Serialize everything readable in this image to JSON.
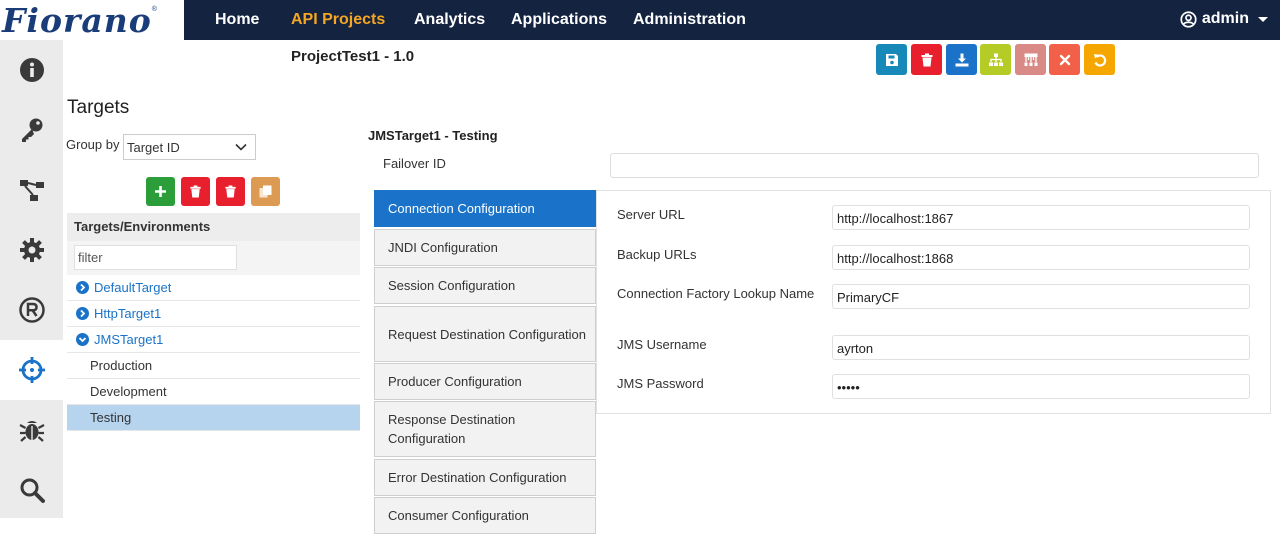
{
  "brand": {
    "logo_text": "Fiorano",
    "reg_mark": "®"
  },
  "nav": {
    "items": [
      {
        "label": "Home"
      },
      {
        "label": "API Projects",
        "active": true
      },
      {
        "label": "Analytics"
      },
      {
        "label": "Applications"
      },
      {
        "label": "Administration"
      }
    ],
    "user_label": "admin"
  },
  "sidebar": {
    "items": [
      {
        "icon": "info-icon"
      },
      {
        "icon": "key-icon"
      },
      {
        "icon": "flow-icon"
      },
      {
        "icon": "gear-icon"
      },
      {
        "icon": "registered-icon"
      },
      {
        "icon": "crosshair-icon",
        "active": true
      },
      {
        "icon": "bug-icon"
      },
      {
        "icon": "search-icon"
      }
    ]
  },
  "header": {
    "project_title": "ProjectTest1 - 1.0",
    "toolbar": [
      {
        "icon": "save-icon",
        "color": "#1789b8"
      },
      {
        "icon": "trash-icon",
        "color": "#e8202e"
      },
      {
        "icon": "download-icon",
        "color": "#1a73c8"
      },
      {
        "icon": "sitemap-icon",
        "color": "#b5cc26"
      },
      {
        "icon": "hierarchy-icon",
        "color": "#d98a86"
      },
      {
        "icon": "close-icon",
        "color": "#f26049"
      },
      {
        "icon": "undo-icon",
        "color": "#f5a700"
      }
    ]
  },
  "targets": {
    "title": "Targets",
    "group_by_label": "Group by",
    "group_by_value": "Target ID",
    "buttons": [
      {
        "icon": "plus-icon",
        "color": "#2b9e3a"
      },
      {
        "icon": "trash-icon",
        "color": "#e8202e"
      },
      {
        "icon": "trash-icon",
        "color": "#e8202e"
      },
      {
        "icon": "copy-icon",
        "color": "#dd9a52"
      }
    ],
    "tree_header": "Targets/Environments",
    "filter_placeholder": "filter",
    "tree": [
      {
        "label": "DefaultTarget",
        "expanded": false
      },
      {
        "label": "HttpTarget1",
        "expanded": false
      },
      {
        "label": "JMSTarget1",
        "expanded": true
      },
      {
        "label": "Production"
      },
      {
        "label": "Development"
      },
      {
        "label": "Testing",
        "selected": true
      }
    ]
  },
  "detail": {
    "title": "JMSTarget1 - Testing",
    "failover_label": "Failover ID",
    "failover_value": "",
    "tabs": [
      {
        "label": "Connection Configuration",
        "active": true
      },
      {
        "label": "JNDI Configuration"
      },
      {
        "label": "Session Configuration"
      },
      {
        "label": "Request Destination Configuration"
      },
      {
        "label": "Producer Configuration"
      },
      {
        "label": "Response Destination Configuration"
      },
      {
        "label": "Error Destination Configuration"
      },
      {
        "label": "Consumer Configuration"
      }
    ],
    "fields": [
      {
        "label": "Server URL",
        "value": "http://localhost:1867"
      },
      {
        "label": "Backup URLs",
        "value": "http://localhost:1868"
      },
      {
        "label": "Connection Factory Lookup Name",
        "value": "PrimaryCF"
      },
      {
        "label": "JMS Username",
        "value": "ayrton"
      },
      {
        "label": "JMS Password",
        "value": "•••••"
      }
    ]
  }
}
